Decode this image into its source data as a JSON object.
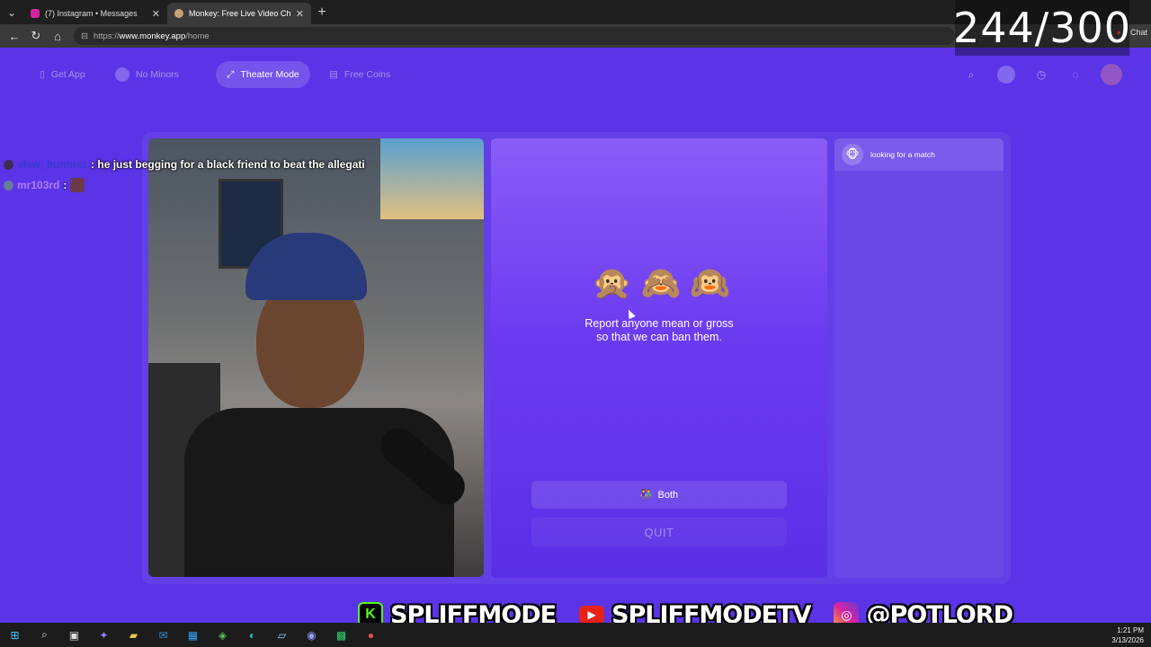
{
  "browser": {
    "tabs": [
      {
        "label": "(7) Instagram • Messages",
        "color": "#d6249f"
      },
      {
        "label": "Monkey: Free Live Video Chat",
        "color": "#c7a277"
      }
    ],
    "url_prefix": "https://",
    "url_host": "www.monkey.app",
    "url_path": "/home",
    "chat_label": "Chat"
  },
  "overlay": {
    "counter": "244/300"
  },
  "header": {
    "get_app": "Get App",
    "no_minors": "No Minors",
    "theater_mode": "Theater Mode",
    "free_coins": "Free Coins"
  },
  "chat": {
    "messages": [
      {
        "user": "slaw_bunniez",
        "text": "he just begging for a black friend to beat the allegati"
      },
      {
        "user": "mr103rd",
        "text": ""
      }
    ]
  },
  "panel": {
    "emojis": [
      "🙊",
      "🙈",
      "🙉"
    ],
    "report_line1": "Report anyone mean or gross",
    "report_line2": "so that we can ban them.",
    "both_icon": "👫",
    "both_label": "Both",
    "quit_label": "QUIT"
  },
  "sidebar": {
    "match_icon": "🐵",
    "match_status": "looking for a match"
  },
  "socials": {
    "kick": "SPLIFFMODE",
    "youtube": "SPLIFFMODETV",
    "instagram": "@POTLORD"
  },
  "taskbar": {
    "time": "1:21 PM",
    "date": "3/13/2026"
  }
}
